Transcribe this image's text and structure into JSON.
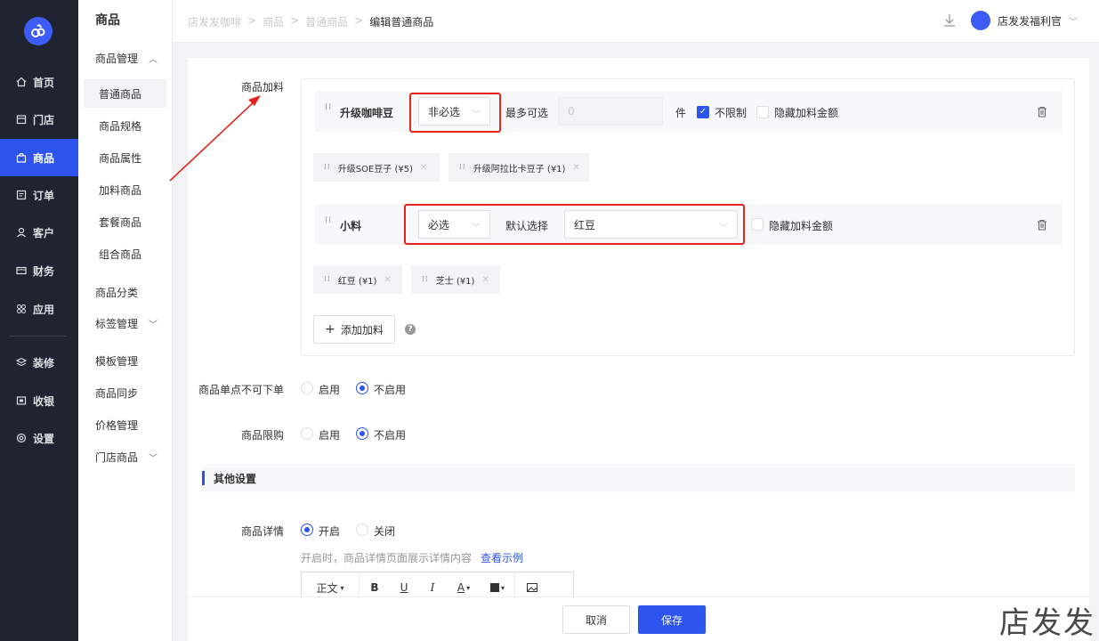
{
  "nav": {
    "items": [
      {
        "label": "首页",
        "icon": "home-icon"
      },
      {
        "label": "门店",
        "icon": "store-icon"
      },
      {
        "label": "商品",
        "icon": "bag-icon"
      },
      {
        "label": "订单",
        "icon": "order-icon"
      },
      {
        "label": "客户",
        "icon": "user-icon"
      },
      {
        "label": "财务",
        "icon": "card-icon"
      },
      {
        "label": "应用",
        "icon": "apps-icon"
      },
      {
        "label": "装修",
        "icon": "layers-icon"
      },
      {
        "label": "收银",
        "icon": "cashier-icon"
      },
      {
        "label": "设置",
        "icon": "settings-icon"
      }
    ],
    "active": "商品"
  },
  "subnav": {
    "title": "商品",
    "group_manage": "商品管理",
    "items": [
      "普通商品",
      "商品规格",
      "商品属性",
      "加料商品",
      "套餐商品",
      "组合商品"
    ],
    "category": "商品分类",
    "tag_manage": "标签管理",
    "template_manage": "模板管理",
    "sync": "商品同步",
    "price": "价格管理",
    "store_goods": "门店商品"
  },
  "topbar": {
    "breadcrumb": [
      "店发发咖啡",
      "商品",
      "普通商品",
      "编辑普通商品"
    ],
    "separator": ">",
    "shop_name": "店发发福利官"
  },
  "form": {
    "addon_label": "商品加料",
    "row1": {
      "title": "升级咖啡豆",
      "select_value": "非必选",
      "max_label": "最多可选",
      "max_value": "0",
      "unit": "件",
      "unlimited_label": "不限制",
      "hide_price_label": "隐藏加料金额"
    },
    "row1_tags": [
      "升级SOE豆子 (¥5)",
      "升级阿拉比卡豆子 (¥1)"
    ],
    "row2": {
      "title": "小料",
      "select_value": "必选",
      "default_label": "默认选择",
      "default_value": "红豆",
      "hide_price_label": "隐藏加料金额"
    },
    "row2_tags": [
      "红豆 (¥1)",
      "芝士 (¥1)"
    ],
    "add_button": "添加加料",
    "help": "?",
    "single_no_order": {
      "label": "商品单点不可下单",
      "opt_on": "启用",
      "opt_off": "不启用"
    },
    "limit": {
      "label": "商品限购",
      "opt_on": "启用",
      "opt_off": "不启用"
    },
    "other_settings": "其他设置",
    "detail": {
      "label": "商品详情",
      "opt_on": "开启",
      "opt_off": "关闭"
    },
    "hint": "开启时，商品详情页面展示详情内容",
    "hint_link": "查看示例",
    "editor": {
      "text_style": "正文",
      "bold": "B",
      "underline": "U",
      "italic": "I",
      "font_color": "A"
    }
  },
  "footer": {
    "cancel": "取消",
    "save": "保存"
  },
  "watermark": "店发发",
  "colors": {
    "primary": "#2e54f0",
    "nav_bg": "#1f2430",
    "annotation": "#e5251d"
  }
}
